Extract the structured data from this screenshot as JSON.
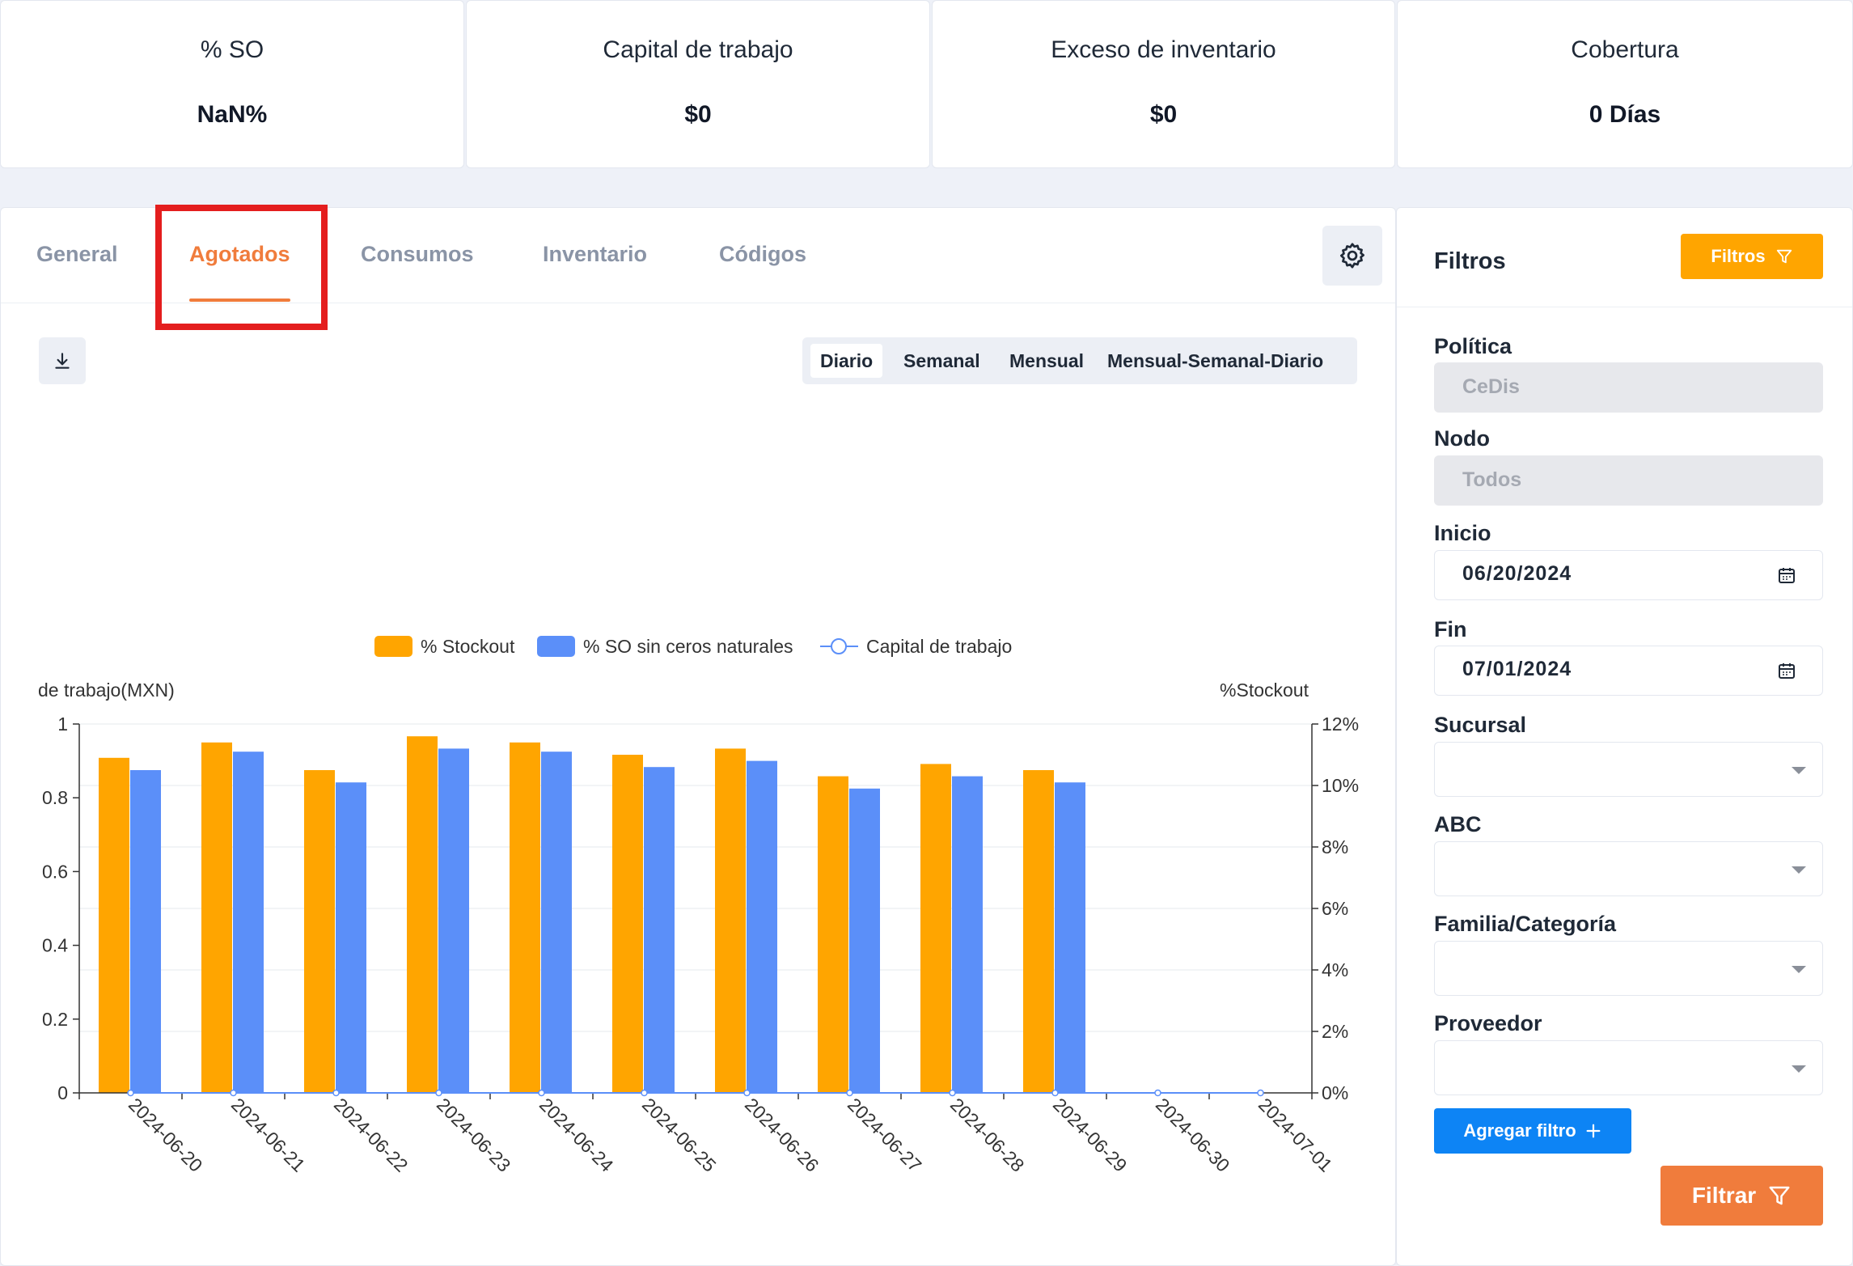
{
  "kpis": [
    {
      "label": "% SO",
      "value": "NaN%"
    },
    {
      "label": "Capital de trabajo",
      "value": "$0"
    },
    {
      "label": "Exceso de inventario",
      "value": "$0"
    },
    {
      "label": "Cobertura",
      "value": "0 Días"
    }
  ],
  "tabs": [
    "General",
    "Agotados",
    "Consumos",
    "Inventario",
    "Códigos"
  ],
  "active_tab": "Agotados",
  "icons": {
    "settings": "gear-icon",
    "download": "download-icon",
    "calendar": "calendar-icon",
    "filter": "funnel-icon",
    "add": "plus-icon"
  },
  "periods": [
    "Diario",
    "Semanal",
    "Mensual",
    "Mensual-Semanal-Diario"
  ],
  "active_period": "Diario",
  "colors": {
    "accent": "#f07c3c",
    "stockout": "#ffa500",
    "so_sin_ceros": "#5b8ff9",
    "capital_line": "#5b8ff9",
    "highlight": "#e41e1e",
    "primary_button": "#0d84f5"
  },
  "chart_data": {
    "type": "bar",
    "categories": [
      "2024-06-20",
      "2024-06-21",
      "2024-06-22",
      "2024-06-23",
      "2024-06-24",
      "2024-06-25",
      "2024-06-26",
      "2024-06-27",
      "2024-06-28",
      "2024-06-29",
      "2024-06-30",
      "2024-07-01"
    ],
    "series": [
      {
        "name": "% Stockout",
        "type": "bar",
        "axis": "right",
        "values": [
          10.9,
          11.4,
          10.5,
          11.6,
          11.4,
          11.0,
          11.2,
          10.3,
          10.7,
          10.5,
          null,
          null
        ]
      },
      {
        "name": "% SO sin ceros naturales",
        "type": "bar",
        "axis": "right",
        "values": [
          10.5,
          11.1,
          10.1,
          11.2,
          11.1,
          10.6,
          10.8,
          9.9,
          10.3,
          10.1,
          null,
          null
        ]
      },
      {
        "name": "Capital de trabajo",
        "type": "line",
        "axis": "left",
        "values": [
          0,
          0,
          0,
          0,
          0,
          0,
          0,
          0,
          0,
          0,
          0,
          0
        ]
      }
    ],
    "ylabel_left": "de trabajo(MXN)",
    "ylabel_right": "%Stockout",
    "ylim_left": [
      0,
      1
    ],
    "yticks_left": [
      "0",
      "0.2",
      "0.4",
      "0.6",
      "0.8",
      "1"
    ],
    "ylim_right": [
      0,
      12
    ],
    "yticks_right": [
      "0%",
      "2%",
      "4%",
      "6%",
      "8%",
      "10%",
      "12%"
    ],
    "legend_position": "top-center",
    "grid": true
  },
  "filters": {
    "title": "Filtros",
    "toggle_label": "Filtros",
    "fields": [
      {
        "label": "Política",
        "kind": "disabled",
        "value": "CeDis"
      },
      {
        "label": "Nodo",
        "kind": "disabled",
        "value": "Todos"
      },
      {
        "label": "Inicio",
        "kind": "date",
        "value": "06/20/2024"
      },
      {
        "label": "Fin",
        "kind": "date",
        "value": "07/01/2024"
      },
      {
        "label": "Sucursal",
        "kind": "select",
        "value": ""
      },
      {
        "label": "ABC",
        "kind": "select",
        "value": ""
      },
      {
        "label": "Familia/Categoría",
        "kind": "select",
        "value": ""
      },
      {
        "label": "Proveedor",
        "kind": "select",
        "value": ""
      }
    ],
    "add_filter_label": "Agregar filtro",
    "apply_label": "Filtrar"
  }
}
